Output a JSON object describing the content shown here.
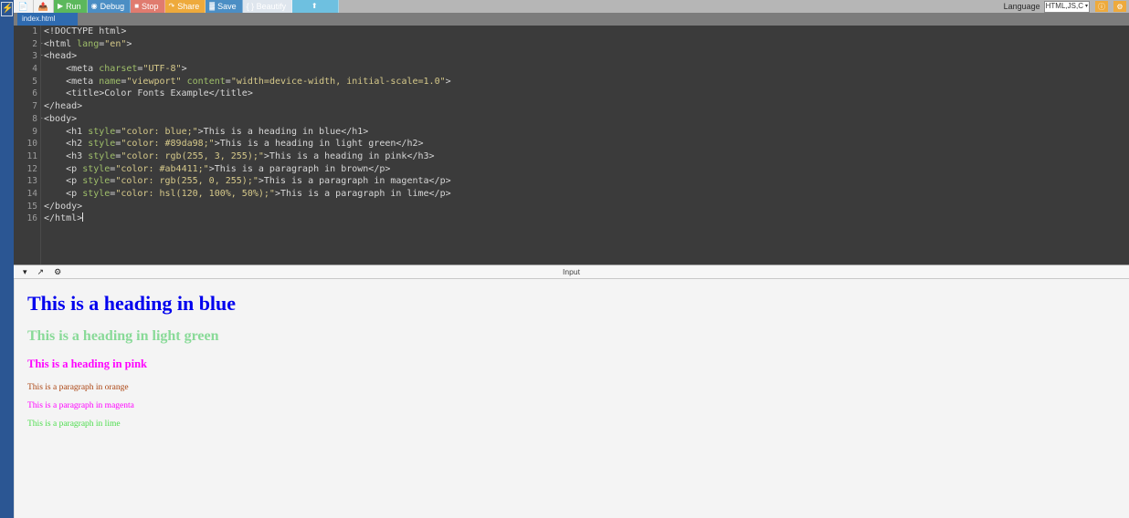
{
  "app": {
    "logo_icon": "lightning-bolt-icon"
  },
  "toolbar": {
    "new_file_icon": "new-file-icon",
    "open_file_icon": "open-folder-icon",
    "buttons": [
      {
        "label": "Run",
        "glyph": "▶",
        "icon": "play-icon",
        "color": "#5cb85c"
      },
      {
        "label": "Debug",
        "glyph": "⊙",
        "icon": "debug-icon",
        "color": "#4b8ec4"
      },
      {
        "label": "Stop",
        "glyph": "■",
        "icon": "stop-icon",
        "color": "#e07b6f"
      },
      {
        "label": "Share",
        "glyph": "↪",
        "icon": "share-icon",
        "color": "#eeaa3c"
      },
      {
        "label": "Save",
        "glyph": "💾",
        "icon": "save-icon",
        "color": "#4b8ec4"
      },
      {
        "label": "{ } Beautify",
        "glyph": "",
        "icon": "beautify-icon",
        "color": "#dfe6ee"
      }
    ],
    "upload_icon": "upload-icon",
    "language_label": "Language",
    "language_value": "HTML,JS,C",
    "language_caret": "▾",
    "info_icon": "info-icon",
    "settings_icon": "gear-icon"
  },
  "tabs": {
    "active_file": "index.html"
  },
  "editor": {
    "line_numbers": [
      "1",
      "2",
      "3",
      "4",
      "5",
      "6",
      "7",
      "8",
      "9",
      "10",
      "11",
      "12",
      "13",
      "14",
      "15",
      "16"
    ],
    "fold_markers": [
      "",
      "·",
      "·",
      "",
      "",
      "",
      "",
      "·",
      "",
      "",
      "",
      "",
      "",
      "",
      "",
      ""
    ],
    "lines": [
      "<!DOCTYPE html>",
      "<html lang=\"en\">",
      "<head>",
      "    <meta charset=\"UTF-8\">",
      "    <meta name=\"viewport\" content=\"width=device-width, initial-scale=1.0\">",
      "    <title>Color Fonts Example</title>",
      "</head>",
      "<body>",
      "    <h1 style=\"color: blue;\">This is a heading in blue</h1>",
      "    <h2 style=\"color: #89da98;\">This is a heading in light green</h2>",
      "    <h3 style=\"color: rgb(255, 3, 255);\">This is a heading in pink</h3>",
      "    <p style=\"color: #ab4411;\">This is a paragraph in brown</p>",
      "    <p style=\"color: rgb(255, 0, 255);\">This is a paragraph in magenta</p>",
      "    <p style=\"color: hsl(120, 100%, 50%);\">This is a paragraph in lime</p>",
      "</body>",
      "</html>"
    ]
  },
  "preview": {
    "collapse_icon": "chevron-down-icon",
    "expand_icon": "expand-diagonal-icon",
    "settings_icon": "gear-icon",
    "title": "Input",
    "rendered": [
      {
        "tag": "h1",
        "text": "This is a heading in blue",
        "color": "#0000ee"
      },
      {
        "tag": "h2",
        "text": "This is a heading in light green",
        "color": "#89da98"
      },
      {
        "tag": "h3",
        "text": "This is a heading in pink",
        "color": "#ff03ff"
      },
      {
        "tag": "p",
        "text": "This is a paragraph in orange",
        "color": "#ab4411"
      },
      {
        "tag": "p",
        "text": "This is a paragraph in magenta",
        "color": "#ff00ff"
      },
      {
        "tag": "p",
        "text": "This is a paragraph in lime",
        "color": "#4ddd4d"
      }
    ]
  }
}
